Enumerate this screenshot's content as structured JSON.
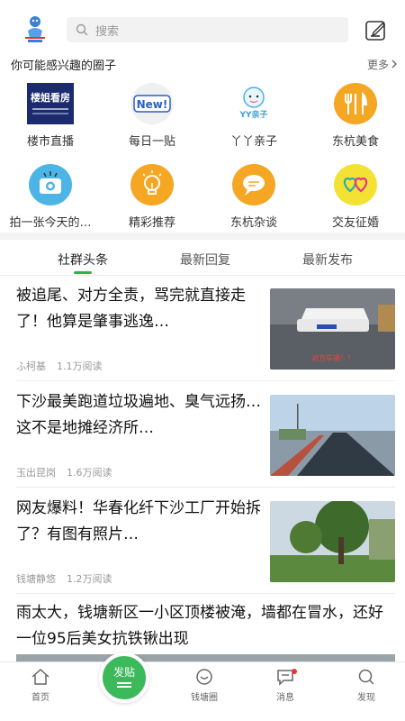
{
  "header": {
    "search_placeholder": "搜索"
  },
  "circles": {
    "title": "你可能感兴趣的圈子",
    "more": "更多",
    "items": [
      {
        "label": "楼市直播",
        "icon": "loushi-kanfang-logo",
        "logo_text": "楼姐看房"
      },
      {
        "label": "每日一贴",
        "icon": "new-badge-icon",
        "logo_text": "New!"
      },
      {
        "label": "丫丫亲子",
        "icon": "yy-parenting-icon",
        "logo_text": "YY亲子"
      },
      {
        "label": "东杭美食",
        "icon": "fork-knife-icon"
      },
      {
        "label": "拍一张今天的…",
        "icon": "camera-icon"
      },
      {
        "label": "精彩推荐",
        "icon": "lightbulb-icon"
      },
      {
        "label": "东杭杂谈",
        "icon": "chat-bubble-icon"
      },
      {
        "label": "交友征婚",
        "icon": "hearts-icon"
      }
    ]
  },
  "tabs": [
    "社群头条",
    "最新回复",
    "最新发布"
  ],
  "articles": [
    {
      "title": "被追尾、对方全责，骂完就直接走了！他算是肇事逃逸…",
      "author": "ふ柯基",
      "reads": "1.1万阅读",
      "thumb_caption": "对方车辆！！"
    },
    {
      "title": "下沙最美跑道垃圾遍地、臭气远扬…这不是地摊经济所…",
      "author": "玉出昆岗",
      "reads": "1.6万阅读"
    },
    {
      "title": "网友爆料！华春化纤下沙工厂开始拆了？有图有照片…",
      "author": "钱塘静悠",
      "reads": "1.2万阅读"
    },
    {
      "title": "雨太大，钱塘新区一小区顶楼被淹，墙都在冒水，还好一位95后美女抗铁锹出现"
    }
  ],
  "bottom_nav": {
    "home": "首页",
    "post": "发贴",
    "circle": "钱塘圈",
    "messages": "消息",
    "discover": "发现"
  },
  "colors": {
    "accent": "#2cb34a",
    "orange": "#f5a623"
  }
}
